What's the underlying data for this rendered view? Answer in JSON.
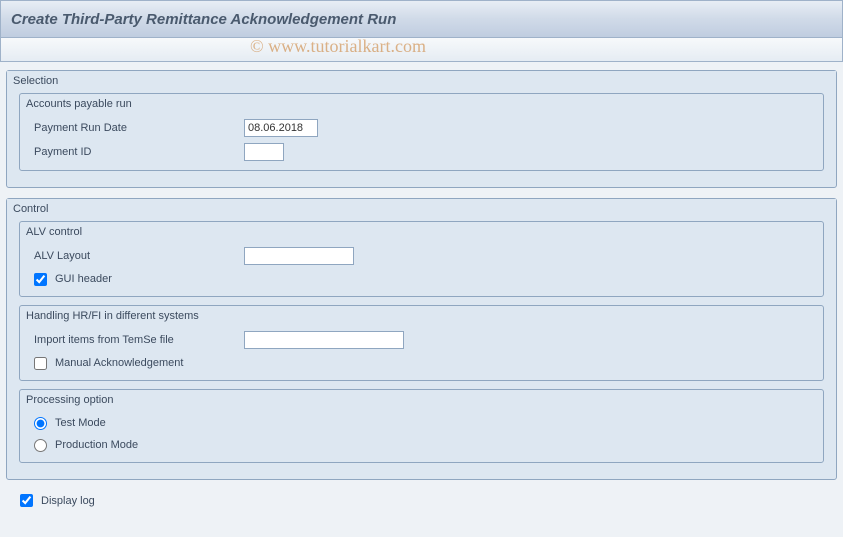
{
  "title": "Create Third-Party Remittance Acknowledgement Run",
  "watermark": "© www.tutorialkart.com",
  "selection": {
    "title": "Selection",
    "accounts_payable": {
      "title": "Accounts payable run",
      "payment_run_date_label": "Payment Run Date",
      "payment_run_date_value": "08.06.2018",
      "payment_id_label": "Payment ID",
      "payment_id_value": ""
    }
  },
  "control": {
    "title": "Control",
    "alv": {
      "title": "ALV control",
      "layout_label": "ALV Layout",
      "layout_value": "",
      "gui_header_label": "GUI header",
      "gui_header_checked": true
    },
    "hrfi": {
      "title": "Handling HR/FI in different systems",
      "import_label": "Import items from TemSe file",
      "import_value": "",
      "manual_ack_label": "Manual Acknowledgement",
      "manual_ack_checked": false
    },
    "processing": {
      "title": "Processing option",
      "test_label": "Test Mode",
      "prod_label": "Production Mode",
      "selected": "test"
    }
  },
  "display_log_label": "Display log",
  "display_log_checked": true
}
